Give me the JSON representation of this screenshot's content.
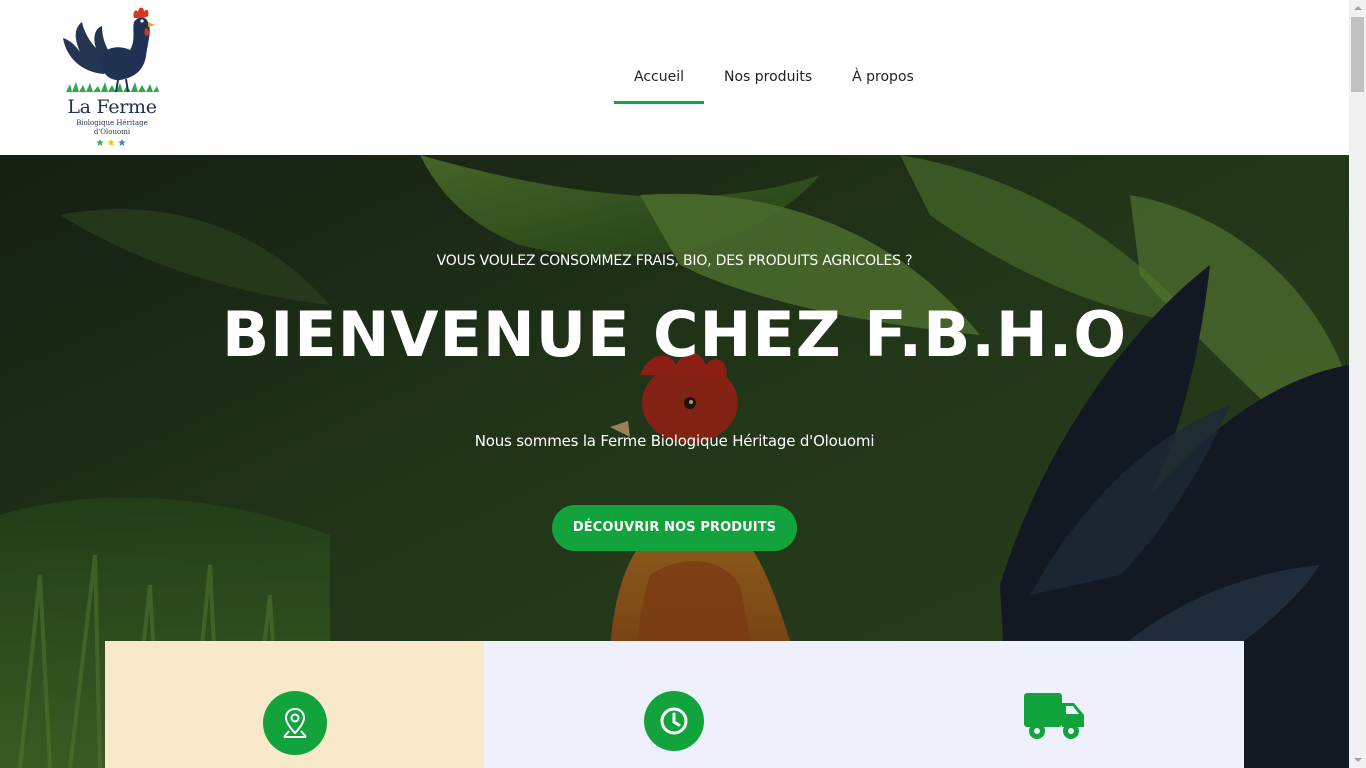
{
  "logo": {
    "title": "La Ferme",
    "subtitle_line1": "Biologique Héritage",
    "subtitle_line2": "d'Olouomi",
    "icon": "rooster-logo-icon"
  },
  "nav": {
    "items": [
      {
        "label": "Accueil",
        "active": true
      },
      {
        "label": "Nos produits",
        "active": false
      },
      {
        "label": "À propos",
        "active": false
      }
    ]
  },
  "hero": {
    "kicker": "VOUS VOULEZ CONSOMMEZ FRAIS, BIO, DES PRODUITS AGRICOLES ?",
    "title": "BIENVENUE CHEZ F.B.H.O",
    "subtitle": "Nous sommes la Ferme Biologique Héritage d'Olouomi",
    "cta_label": "DÉCOUVRIR NOS PRODUITS",
    "background": "rooster-photo"
  },
  "features": [
    {
      "icon": "map-pin-icon"
    },
    {
      "icon": "clock-icon"
    },
    {
      "icon": "delivery-truck-icon"
    }
  ],
  "colors": {
    "accent": "#12a33c",
    "feature_1_bg": "#f9e9cb",
    "feature_2_bg": "#eef1fb",
    "logo_text": "#1f3254"
  }
}
